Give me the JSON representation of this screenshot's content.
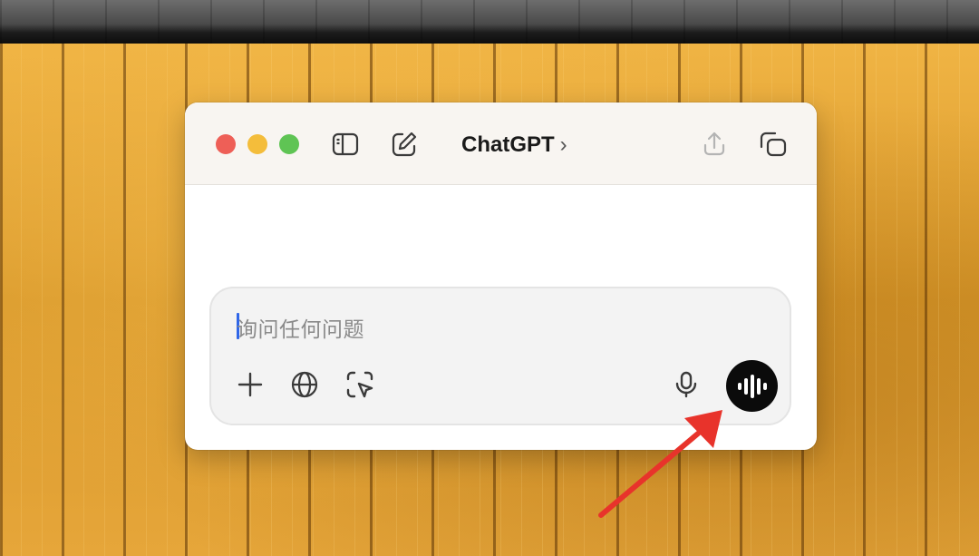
{
  "window": {
    "title": "ChatGPT",
    "title_chevron": "›"
  },
  "titlebar_icons": {
    "left": [
      "sidebar-toggle-icon",
      "new-chat-icon"
    ],
    "right": [
      "share-icon",
      "popout-window-icon"
    ]
  },
  "composer": {
    "placeholder": "询问任何问题",
    "tools": [
      "plus-icon",
      "globe-icon",
      "screen-capture-icon"
    ],
    "right_icons": [
      "microphone-icon",
      "voice-mode-icon"
    ]
  },
  "colors": {
    "accent_caret": "#2f66e8",
    "voice_button": "#0b0b0b",
    "annotation_arrow": "#e8332b",
    "traffic_red": "#ee5f57",
    "traffic_yellow": "#f4bd3b",
    "traffic_green": "#5fc454"
  }
}
